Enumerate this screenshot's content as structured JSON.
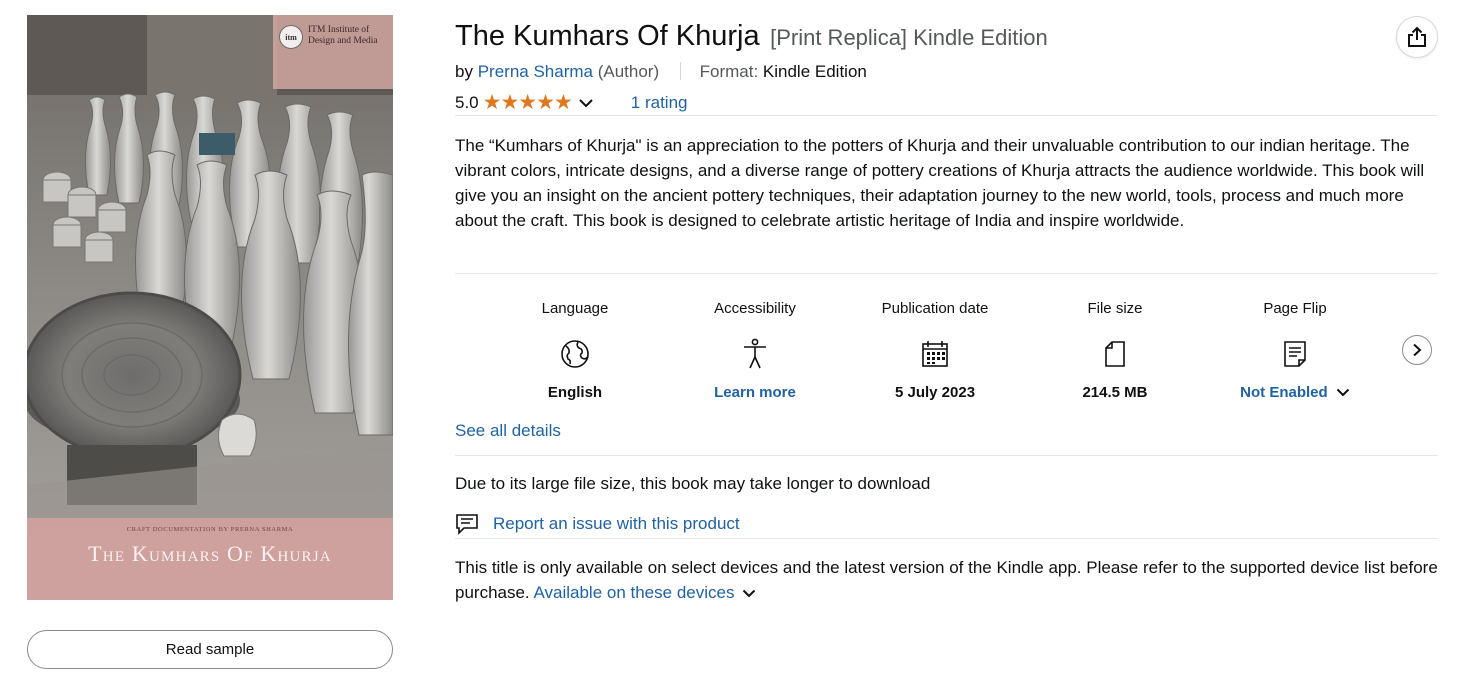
{
  "cover": {
    "publisher": "ITM Institute of Design and Media",
    "publisher_logo_text": "itm",
    "subline": "CRAFT DOCUMENTATION BY PRERNA SHARMA",
    "title": "The Kumhars Of Khurja"
  },
  "read_sample_label": "Read sample",
  "product": {
    "title": "The Kumhars Of Khurja",
    "edition": "[Print Replica] Kindle Edition",
    "by": "by",
    "author": "Prerna Sharma",
    "author_role": "(Author)",
    "format_label": "Format:",
    "format_value": "Kindle Edition",
    "rating_value": "5.0",
    "stars": "★★★★★",
    "rating_count": "1 rating"
  },
  "description": "The “Kumhars of Khurja\" is an appreciation to the potters of Khurja and their unvaluable contribution to our indian heritage. The vibrant colors, intricate designs, and a diverse range of pottery creations of Khurja attracts the audience worldwide. This book will give you an insight on the ancient pottery techniques, their adaptation journey to the new world, tools, process and much more about the craft. This book is designed to celebrate artistic heritage of India and inspire worldwide.",
  "attributes": [
    {
      "label": "Language",
      "icon": "globe-icon",
      "value": "English"
    },
    {
      "label": "Accessibility",
      "icon": "person-icon",
      "value": "Learn more"
    },
    {
      "label": "Publication date",
      "icon": "calendar-icon",
      "value": "5 July 2023"
    },
    {
      "label": "File size",
      "icon": "file-icon",
      "value": "214.5 MB"
    },
    {
      "label": "Page Flip",
      "icon": "page-flip-icon",
      "value": "Not Enabled"
    }
  ],
  "see_all_details": "See all details",
  "download_note": "Due to its large file size, this book may take longer to download",
  "report_issue": "Report an issue with this product",
  "devices_note": "This title is only available on select devices and the latest version of the Kindle app. Please refer to the supported device list before purchase.",
  "devices_link": "Available on these devices",
  "colors": {
    "link": "#2162a1",
    "star": "#de7921",
    "text": "#0f1111",
    "muted": "#565959",
    "cover_band": "#d3a09e"
  }
}
